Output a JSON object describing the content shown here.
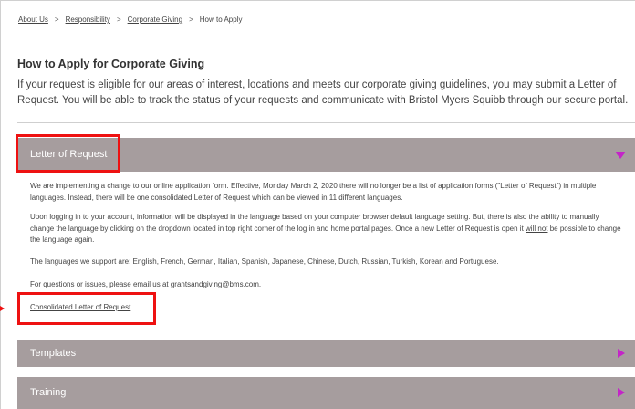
{
  "breadcrumb": {
    "items": [
      "About Us",
      "Responsibility",
      "Corporate Giving"
    ],
    "current": "How to Apply",
    "separator": ">"
  },
  "page": {
    "title": "How to Apply for Corporate Giving",
    "intro": {
      "t1": "If your request is eligible for our ",
      "link1": "areas of interest",
      "t2": ", ",
      "link2": "locations",
      "t3": " and meets our ",
      "link3": "corporate giving guidelines",
      "t4": ", you may submit a Letter of Request. You will be able to track the status of your requests and communicate with Bristol Myers Squibb through our secure portal."
    }
  },
  "accordion": {
    "letter": {
      "title": "Letter of Request",
      "p1": "We are implementing a change to our online application form. Effective, Monday March 2, 2020 there will no longer be a list of application forms (\"Letter of Request\") in multiple languages. Instead, there will be one consolidated Letter of Request which can be viewed in 11 different languages.",
      "p2a": "Upon logging in to your account, information will be displayed in the language based on your computer browser default language setting. But, there is also the ability to manually change the language by clicking on the dropdown located in top right corner of the log in and home portal pages. Once a new Letter of Request is open it ",
      "p2u": "will not",
      "p2b": " be possible to change the language again.",
      "p3": "The languages we support are: English, French, German, Italian, Spanish, Japanese, Chinese, Dutch, Russian, Turkish, Korean and Portuguese.",
      "p4a": "For questions or issues, please email us at ",
      "email": "grantsandgiving@bms.com",
      "p4b": ".",
      "link": "Consolidated Letter of Request"
    },
    "templates": {
      "title": "Templates"
    },
    "training": {
      "title": "Training"
    }
  },
  "colors": {
    "accordion_header": "#a69d9e",
    "expand_arrow": "#c424c8",
    "highlight": "#ee1111"
  }
}
